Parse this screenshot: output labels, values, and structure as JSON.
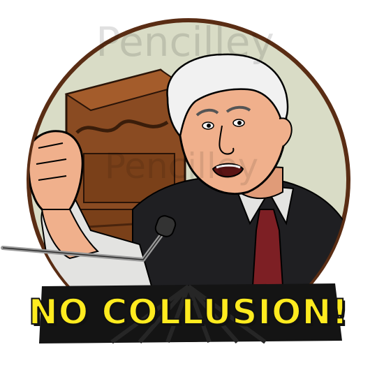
{
  "watermark": {
    "text": "Pencilley"
  },
  "caption": {
    "text": "NO COLLUSION!"
  },
  "colors": {
    "circle_bg": "#d9dcc6",
    "circle_ring": "#5a2d14",
    "wood": "#8a4b22",
    "wood_dark": "#5e3015",
    "suit": "#1f1f22",
    "shirt": "#e3e3e1",
    "tie": "#7d1f24",
    "skin": "#f0b08c",
    "hair": "#f1f1f1",
    "banner": "#141414",
    "caption_fill": "#ffeb1f"
  }
}
